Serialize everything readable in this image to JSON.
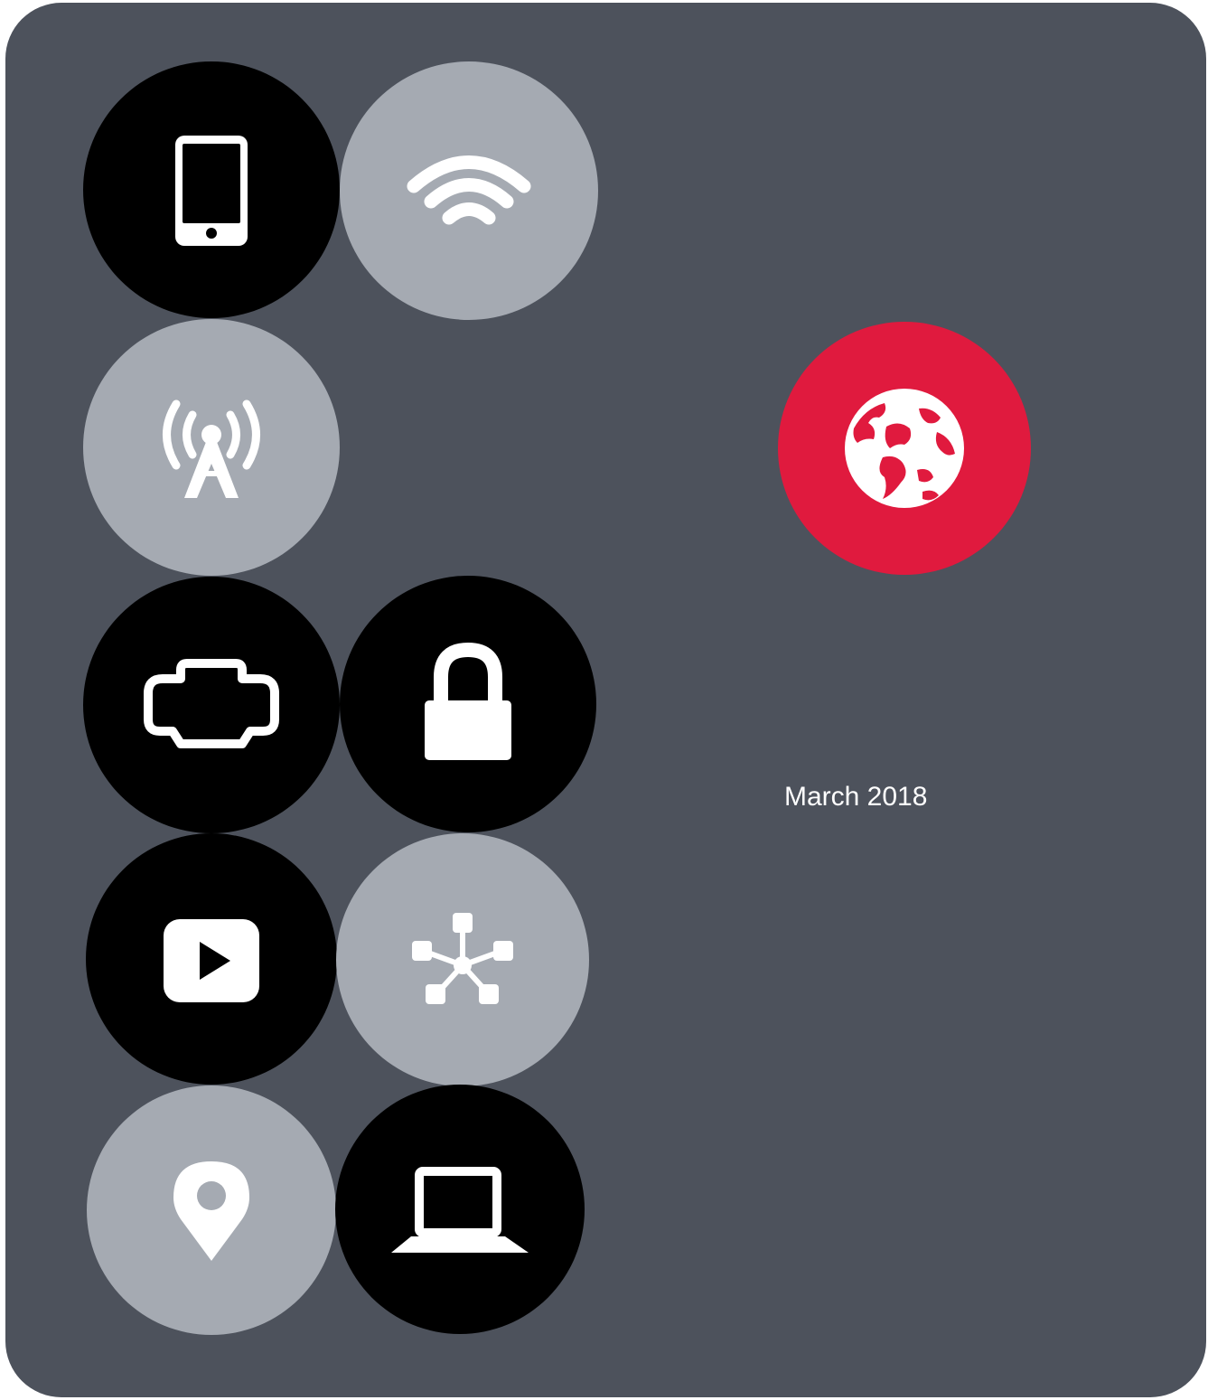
{
  "date_label": "March 2018",
  "icons": [
    {
      "name": "mobile-phone-icon",
      "fill": "dark"
    },
    {
      "name": "wifi-icon",
      "fill": "light"
    },
    {
      "name": "cell-tower-icon",
      "fill": "light"
    },
    {
      "name": "connector-port-icon",
      "fill": "dark"
    },
    {
      "name": "lock-icon",
      "fill": "dark"
    },
    {
      "name": "play-icon",
      "fill": "dark"
    },
    {
      "name": "network-hub-icon",
      "fill": "light"
    },
    {
      "name": "location-pin-icon",
      "fill": "light"
    },
    {
      "name": "laptop-icon",
      "fill": "dark"
    },
    {
      "name": "globe-icon",
      "fill": "red"
    }
  ],
  "colors": {
    "panel": "#4d525c",
    "dark_circle": "#000000",
    "light_circle": "#a5aab2",
    "accent": "#e01a3e",
    "icon": "#ffffff"
  }
}
